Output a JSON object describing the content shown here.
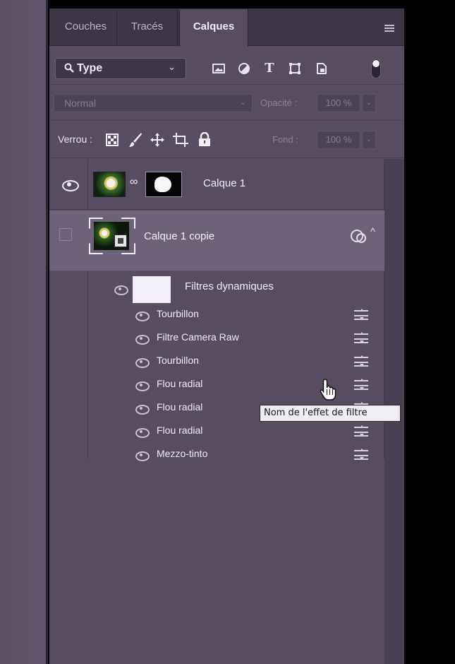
{
  "tabs": [
    {
      "label": "Couches",
      "active": false
    },
    {
      "label": "Tracés",
      "active": false
    },
    {
      "label": "Calques",
      "active": true
    }
  ],
  "filter": {
    "kind_label": "Type",
    "icons": [
      "image-filter-icon",
      "adjustment-filter-icon",
      "type-filter-icon",
      "shape-filter-icon",
      "smart-object-filter-icon",
      "filter-toggle-icon"
    ]
  },
  "blend": {
    "mode": "Normal",
    "opacity_label": "Opacité :",
    "opacity_value": "100 %"
  },
  "lock": {
    "label": "Verrou :",
    "icons": [
      "lock-pixels-transparent-icon",
      "lock-image-pixels-icon",
      "lock-position-icon",
      "lock-artboard-icon",
      "lock-all-icon"
    ],
    "fill_label": "Fond :",
    "fill_value": "100 %"
  },
  "layers": [
    {
      "name": "Calque 1",
      "visible": true,
      "has_mask": true
    },
    {
      "name": "Calque 1 copie",
      "visible": false,
      "selected": true,
      "smart_object": true
    }
  ],
  "smart_filters": {
    "label": "Filtres dynamiques",
    "items": [
      {
        "name": "Tourbillon"
      },
      {
        "name": "Filtre Camera Raw"
      },
      {
        "name": "Tourbillon"
      },
      {
        "name": "Flou radial"
      },
      {
        "name": "Flou radial"
      },
      {
        "name": "Flou radial"
      },
      {
        "name": "Mezzo-tinto"
      }
    ]
  },
  "tooltip": "Nom de l'effet de filtre",
  "colors": {
    "panel_bg": "#574c60",
    "selected_row": "#6e6278",
    "tab_bar": "#3e3547",
    "tooltip_bg": "#f0eef2"
  }
}
